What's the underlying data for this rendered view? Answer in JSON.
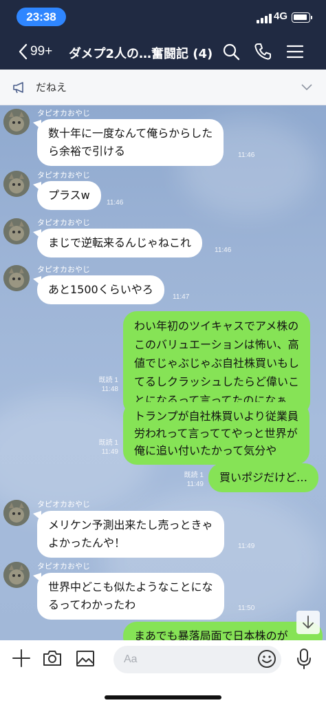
{
  "status_bar": {
    "time": "23:38",
    "network": "4G"
  },
  "nav": {
    "back_count": "99+",
    "title": "ダメプ2人の…奮闘記 (4)",
    "icons": [
      "search-icon",
      "phone-icon",
      "menu-icon"
    ]
  },
  "announcement": {
    "text": "だねえ"
  },
  "messages": [
    {
      "dir": "in",
      "sender": "タピオカおやじ",
      "lines": [
        "数十年に一度なんて俺らからした",
        "ら余裕で引ける"
      ],
      "time": "11:46"
    },
    {
      "dir": "in",
      "sender": "タピオカおやじ",
      "lines": [
        "プラスw"
      ],
      "time": "11:46"
    },
    {
      "dir": "in",
      "sender": "タピオカおやじ",
      "lines": [
        "まじで逆転来るんじゃねこれ"
      ],
      "time": "11:46"
    },
    {
      "dir": "in",
      "sender": "タピオカおやじ",
      "lines": [
        "あと1500くらいやろ"
      ],
      "time": "11:47"
    },
    {
      "dir": "out",
      "read": "既読 1",
      "lines": [
        "わい年初のツイキャスでアメ株の",
        "このバリュエーションは怖い、高",
        "値でじゃぶじゃぶ自社株買いもし",
        "てるしクラッシュしたらど偉いこ",
        "とになるって言ってたのになぁ"
      ],
      "time": "11:48"
    },
    {
      "dir": "out",
      "read": "既読 1",
      "lines": [
        "トランプが自社株買いより従業員",
        "労われって言っててやっと世界が",
        "俺に追い付いたかって気分や"
      ],
      "time": "11:49"
    },
    {
      "dir": "out",
      "read": "既読 1",
      "lines": [
        "買いポジだけど…"
      ],
      "time": "11:49"
    },
    {
      "dir": "in",
      "sender": "タピオカおやじ",
      "lines": [
        "メリケン予測出来たし売っときゃ",
        "よかったんや！"
      ],
      "time": "11:49"
    },
    {
      "dir": "in",
      "sender": "タピオカおやじ",
      "lines": [
        "世界中どこも似たようなことにな",
        "るってわかったわ"
      ],
      "time": "11:50"
    },
    {
      "dir": "out",
      "read": "",
      "lines": [
        "まあでも暴落局面で日本株のが"
      ],
      "time": ""
    }
  ],
  "input": {
    "placeholder": "Aa",
    "icons": [
      "plus-icon",
      "camera-icon",
      "image-icon",
      "emoji-icon",
      "microphone-icon"
    ]
  },
  "colors": {
    "header": "#202a42",
    "bubble_out": "#86e356",
    "bubble_in": "#ffffff",
    "time_pill": "#2f86ff"
  }
}
